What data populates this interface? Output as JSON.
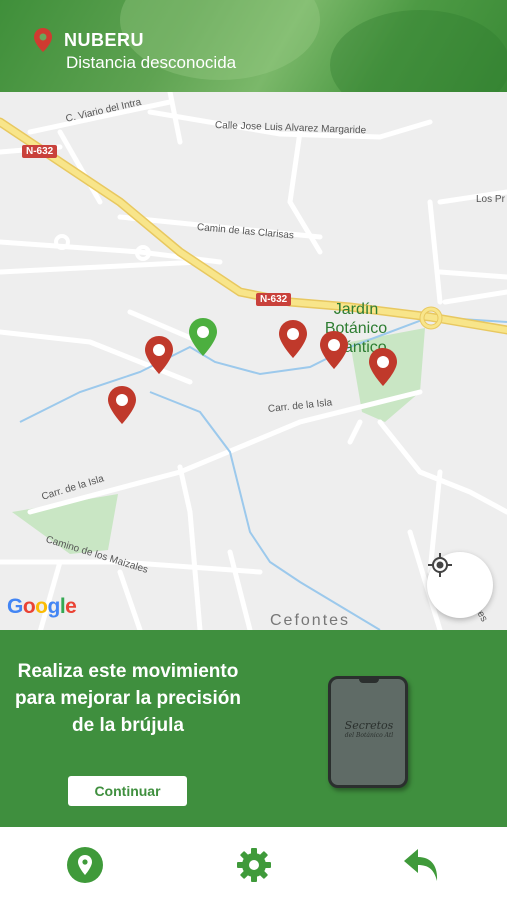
{
  "header": {
    "title": "NUBERU",
    "subtitle": "Distancia desconocida",
    "icon": "location-pin-icon"
  },
  "map": {
    "roads": {
      "c_viario": "C. Viario del Intra",
      "jose_luis": "Calle Jose Luis Alvarez Margaride",
      "clarisas": "Camin de las Clarisas",
      "los_pr": "Los Pr",
      "isla_right": "Carr. de la Isla",
      "isla_left": "Carr. de la Isla",
      "maizales": "Camino de los Maizales",
      "tes": "tes"
    },
    "shields": [
      "N-632",
      "N-632"
    ],
    "place": "Jardín Botánico Atlántico",
    "town": "Cefontes",
    "google": [
      "G",
      "o",
      "o",
      "g",
      "l",
      "e"
    ],
    "colors": {
      "marker_red": "#c0392b",
      "marker_green": "#4caf3f",
      "park": "#c9e6c4"
    }
  },
  "calibration": {
    "message": "Realiza este movimiento para mejorar la precisión de la brújula",
    "button": "Continuar",
    "phone_text_line1": "Secretos",
    "phone_text_line2": "del Botánico Atl"
  },
  "bottom_nav": {
    "items": [
      "location-pin-icon",
      "gear-icon",
      "back-arrow-icon"
    ],
    "color": "#3f9a3a"
  }
}
